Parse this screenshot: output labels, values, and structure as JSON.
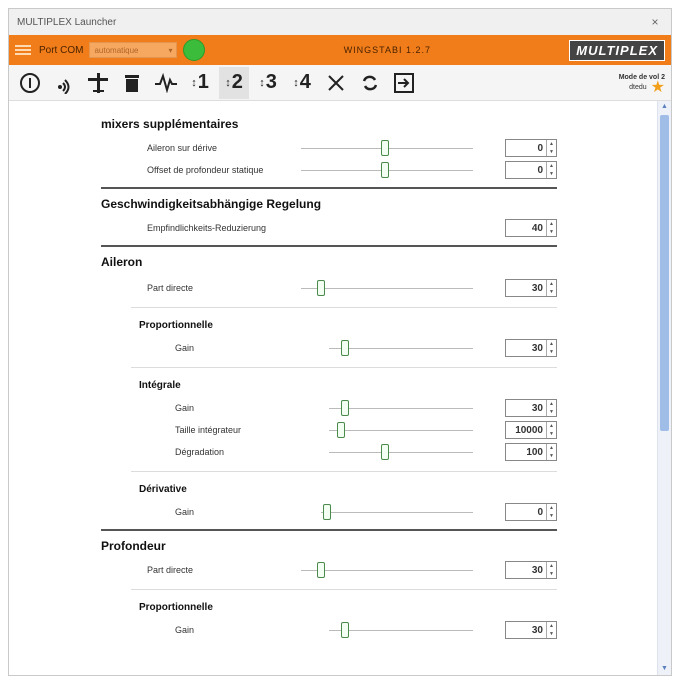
{
  "window": {
    "title": "MULTIPLEX Launcher",
    "close": "×"
  },
  "header": {
    "port_label": "Port COM",
    "port_value": "automatique",
    "app_title": "WINGSTABI 1.2.7",
    "brand": "MULTIPLEX"
  },
  "toolbar": {
    "items": [
      {
        "name": "info",
        "kind": "icon"
      },
      {
        "name": "radio",
        "kind": "icon"
      },
      {
        "name": "plane",
        "kind": "icon"
      },
      {
        "name": "trash",
        "kind": "icon"
      },
      {
        "name": "pulse",
        "kind": "icon"
      },
      {
        "name": "tab-1",
        "text": "1"
      },
      {
        "name": "tab-2",
        "text": "2"
      },
      {
        "name": "tab-3",
        "text": "3"
      },
      {
        "name": "tab-4",
        "text": "4"
      },
      {
        "name": "tools",
        "kind": "icon"
      },
      {
        "name": "refresh",
        "kind": "icon"
      },
      {
        "name": "export",
        "kind": "icon"
      }
    ],
    "mode_label": "Mode de vol 2",
    "mode_sub": "dtedu"
  },
  "sections": {
    "mixers": {
      "title": "mixers supplémentaires",
      "rows": [
        {
          "label": "Aileron sur dérive",
          "value": "0"
        },
        {
          "label": "Offset de profondeur statique",
          "value": "0"
        }
      ]
    },
    "regelung": {
      "title": "Geschwindigkeitsabhängige Regelung",
      "rows": [
        {
          "label": "Empfindlichkeits-Reduzierung",
          "value": "40"
        }
      ]
    },
    "aileron": {
      "title": "Aileron",
      "direct": {
        "label": "Part directe",
        "value": "30"
      },
      "prop": {
        "title": "Proportionnelle",
        "rows": [
          {
            "label": "Gain",
            "value": "30"
          }
        ]
      },
      "integ": {
        "title": "Intégrale",
        "rows": [
          {
            "label": "Gain",
            "value": "30"
          },
          {
            "label": "Taille intégrateur",
            "value": "10000"
          },
          {
            "label": "Dégradation",
            "value": "100"
          }
        ]
      },
      "deriv": {
        "title": "Dérivative",
        "rows": [
          {
            "label": "Gain",
            "value": "0"
          }
        ]
      }
    },
    "profondeur": {
      "title": "Profondeur",
      "direct": {
        "label": "Part directe",
        "value": "30"
      },
      "prop": {
        "title": "Proportionnelle",
        "rows": [
          {
            "label": "Gain",
            "value": "30"
          }
        ]
      }
    }
  }
}
